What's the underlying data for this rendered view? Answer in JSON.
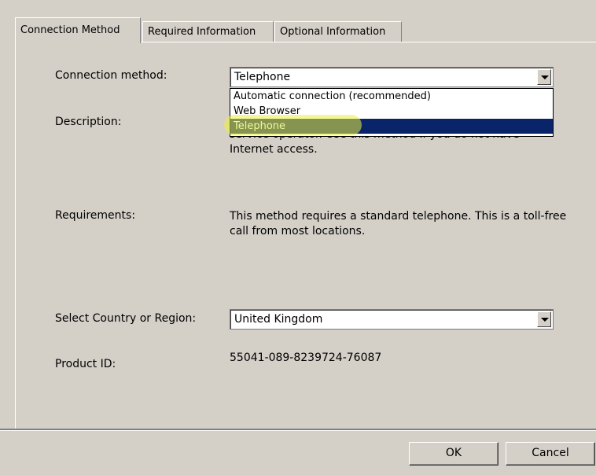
{
  "tabs": [
    "Connection Method",
    "Required Information",
    "Optional Information"
  ],
  "form": {
    "connection_method_label": "Connection method:",
    "connection_method_value": "Telephone",
    "connection_options": [
      "Automatic connection (recommended)",
      "Web Browser",
      "Telephone"
    ],
    "description_label": "Description:",
    "description_text": "Use this method to activate by speaking with a customer service operator. Use this method if you do not have Internet access.",
    "requirements_label": "Requirements:",
    "requirements_text": "This method requires a standard telephone. This is a toll-free call from most locations.",
    "country_label": "Select Country or Region:",
    "country_value": "United Kingdom",
    "product_id_label": "Product ID:",
    "product_id_value": "55041-089-8239724-76087"
  },
  "buttons": {
    "ok": "OK",
    "cancel": "Cancel"
  },
  "colors": {
    "window_bg": "#d4d0c8",
    "selection": "#0a246a",
    "highlight": "#ebf03c"
  }
}
